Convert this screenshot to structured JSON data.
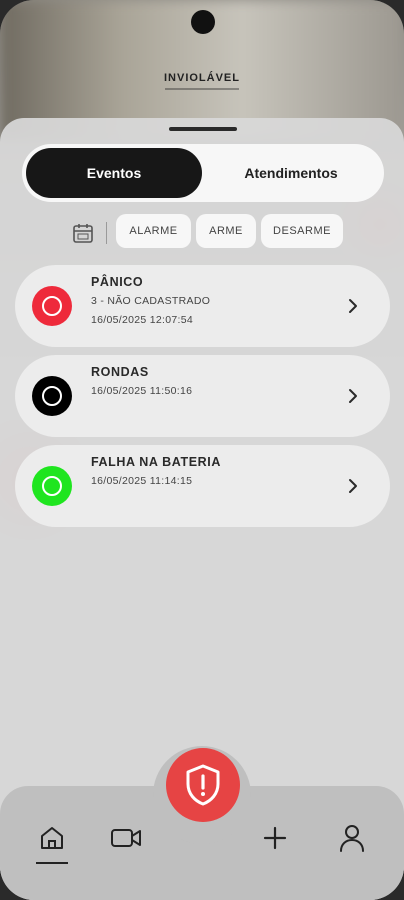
{
  "brand": {
    "name": "INVIOLÁVEL"
  },
  "tabs": [
    {
      "label": "Eventos",
      "active": true
    },
    {
      "label": "Atendimentos",
      "active": false
    }
  ],
  "filters": {
    "calendar_icon": "calendar-icon",
    "chips": [
      "ALARME",
      "ARME",
      "DESARME"
    ]
  },
  "events": [
    {
      "title": "PÂNICO",
      "subtitle": "3 - NÃO CADASTRADO",
      "timestamp": "16/05/2025 12:07:54",
      "status_color": "#ee2a3b"
    },
    {
      "title": "RONDAS",
      "subtitle": "",
      "timestamp": "16/05/2025 11:50:16",
      "status_color": "#000000"
    },
    {
      "title": "FALHA NA BATERIA",
      "subtitle": "",
      "timestamp": "16/05/2025 11:14:15",
      "status_color": "#1fe51f"
    }
  ],
  "bottom_nav": {
    "items": [
      "home-icon",
      "video-icon",
      "plus-icon",
      "user-icon"
    ],
    "active": "home-icon",
    "center_action": "shield-alert-icon",
    "center_color": "#e64444"
  }
}
